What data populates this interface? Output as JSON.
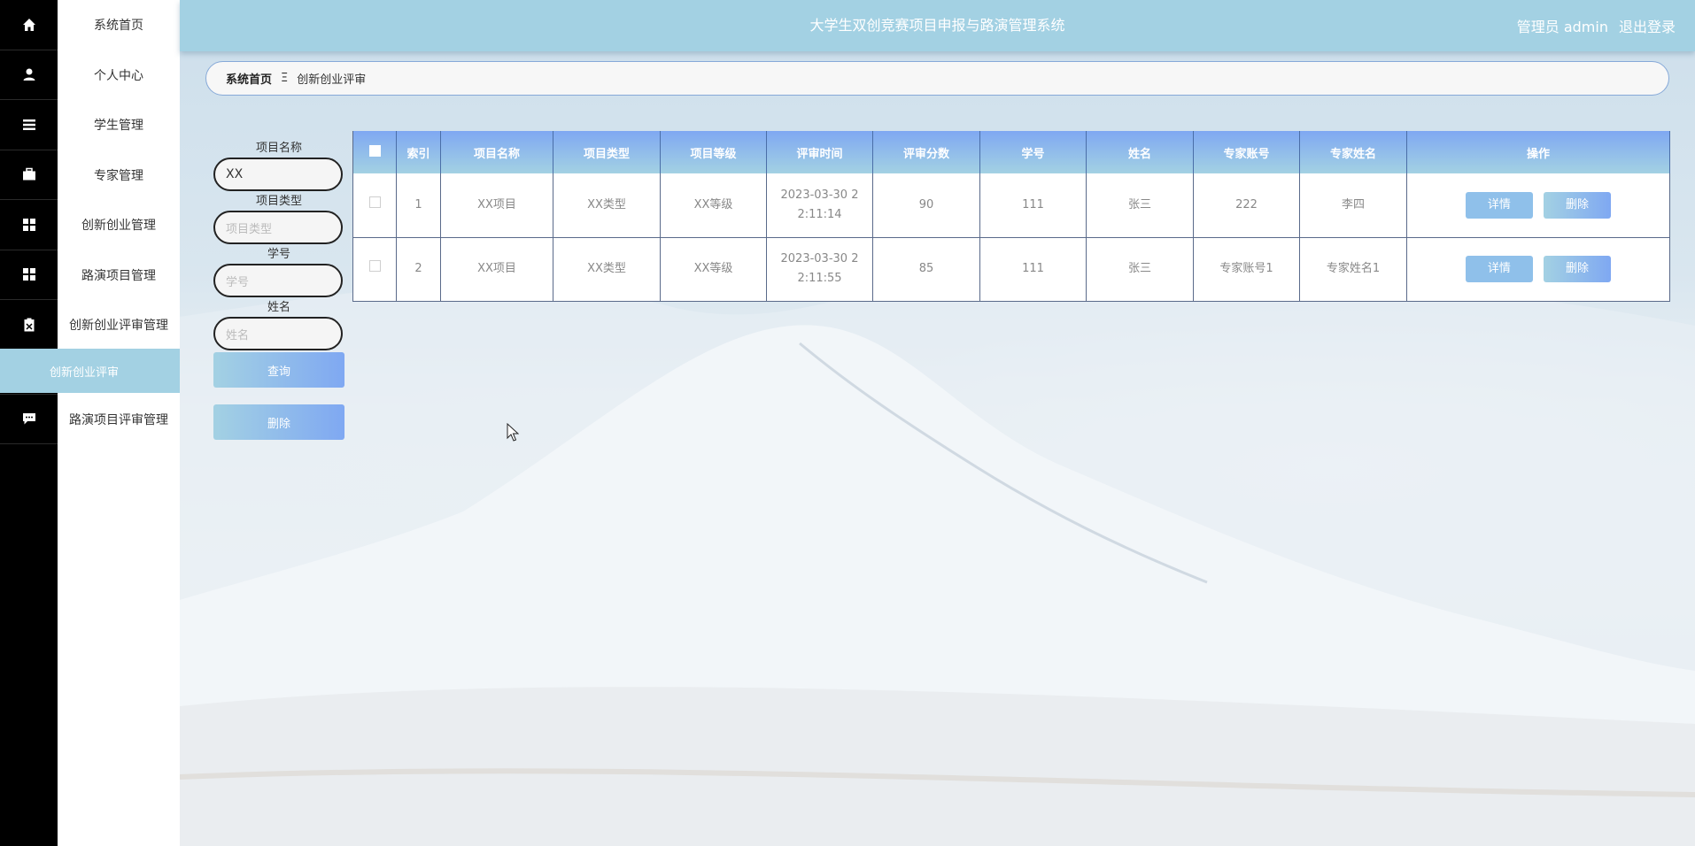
{
  "header": {
    "title": "大学生双创竞赛项目申报与路演管理系统",
    "user_label": "管理员 admin",
    "logout": "退出登录"
  },
  "sidebar": {
    "items": [
      {
        "label": "系统首页",
        "icon": "home-icon"
      },
      {
        "label": "个人中心",
        "icon": "user-icon"
      },
      {
        "label": "学生管理",
        "icon": "list-icon"
      },
      {
        "label": "专家管理",
        "icon": "briefcase-icon"
      },
      {
        "label": "创新创业管理",
        "icon": "grid-icon"
      },
      {
        "label": "路演项目管理",
        "icon": "grid-icon"
      },
      {
        "label": "创新创业评审管理",
        "icon": "clipboard-icon"
      }
    ],
    "active_sub": "创新创业评审",
    "after_items": [
      {
        "label": "路演项目评审管理",
        "icon": "chat-icon"
      }
    ]
  },
  "breadcrumb": {
    "home": "系统首页",
    "separator": "Ξ",
    "current": "创新创业评审"
  },
  "search": {
    "project_name_label": "项目名称",
    "project_name_value": "XX",
    "project_type_label": "项目类型",
    "project_type_placeholder": "项目类型",
    "student_no_label": "学号",
    "student_no_placeholder": "学号",
    "name_label": "姓名",
    "name_placeholder": "姓名",
    "query_button": "查询",
    "delete_button": "删除"
  },
  "table": {
    "columns": [
      "索引",
      "项目名称",
      "项目类型",
      "项目等级",
      "评审时间",
      "评审分数",
      "学号",
      "姓名",
      "专家账号",
      "专家姓名",
      "操作"
    ],
    "rows": [
      {
        "index": "1",
        "project_name": "XX项目",
        "project_type": "XX类型",
        "project_level": "XX等级",
        "review_time": "2023-03-30 22:11:14",
        "score": "90",
        "student_no": "111",
        "name": "张三",
        "expert_account": "222",
        "expert_name": "李四"
      },
      {
        "index": "2",
        "project_name": "XX项目",
        "project_type": "XX类型",
        "project_level": "XX等级",
        "review_time": "2023-03-30 22:11:55",
        "score": "85",
        "student_no": "111",
        "name": "张三",
        "expert_account": "专家账号1",
        "expert_name": "专家姓名1"
      }
    ],
    "detail_button": "详情",
    "delete_button": "删除"
  },
  "colors": {
    "accent_light": "#a3d1e3",
    "accent_blue": "#7fa8f2",
    "rail": "#000000"
  }
}
